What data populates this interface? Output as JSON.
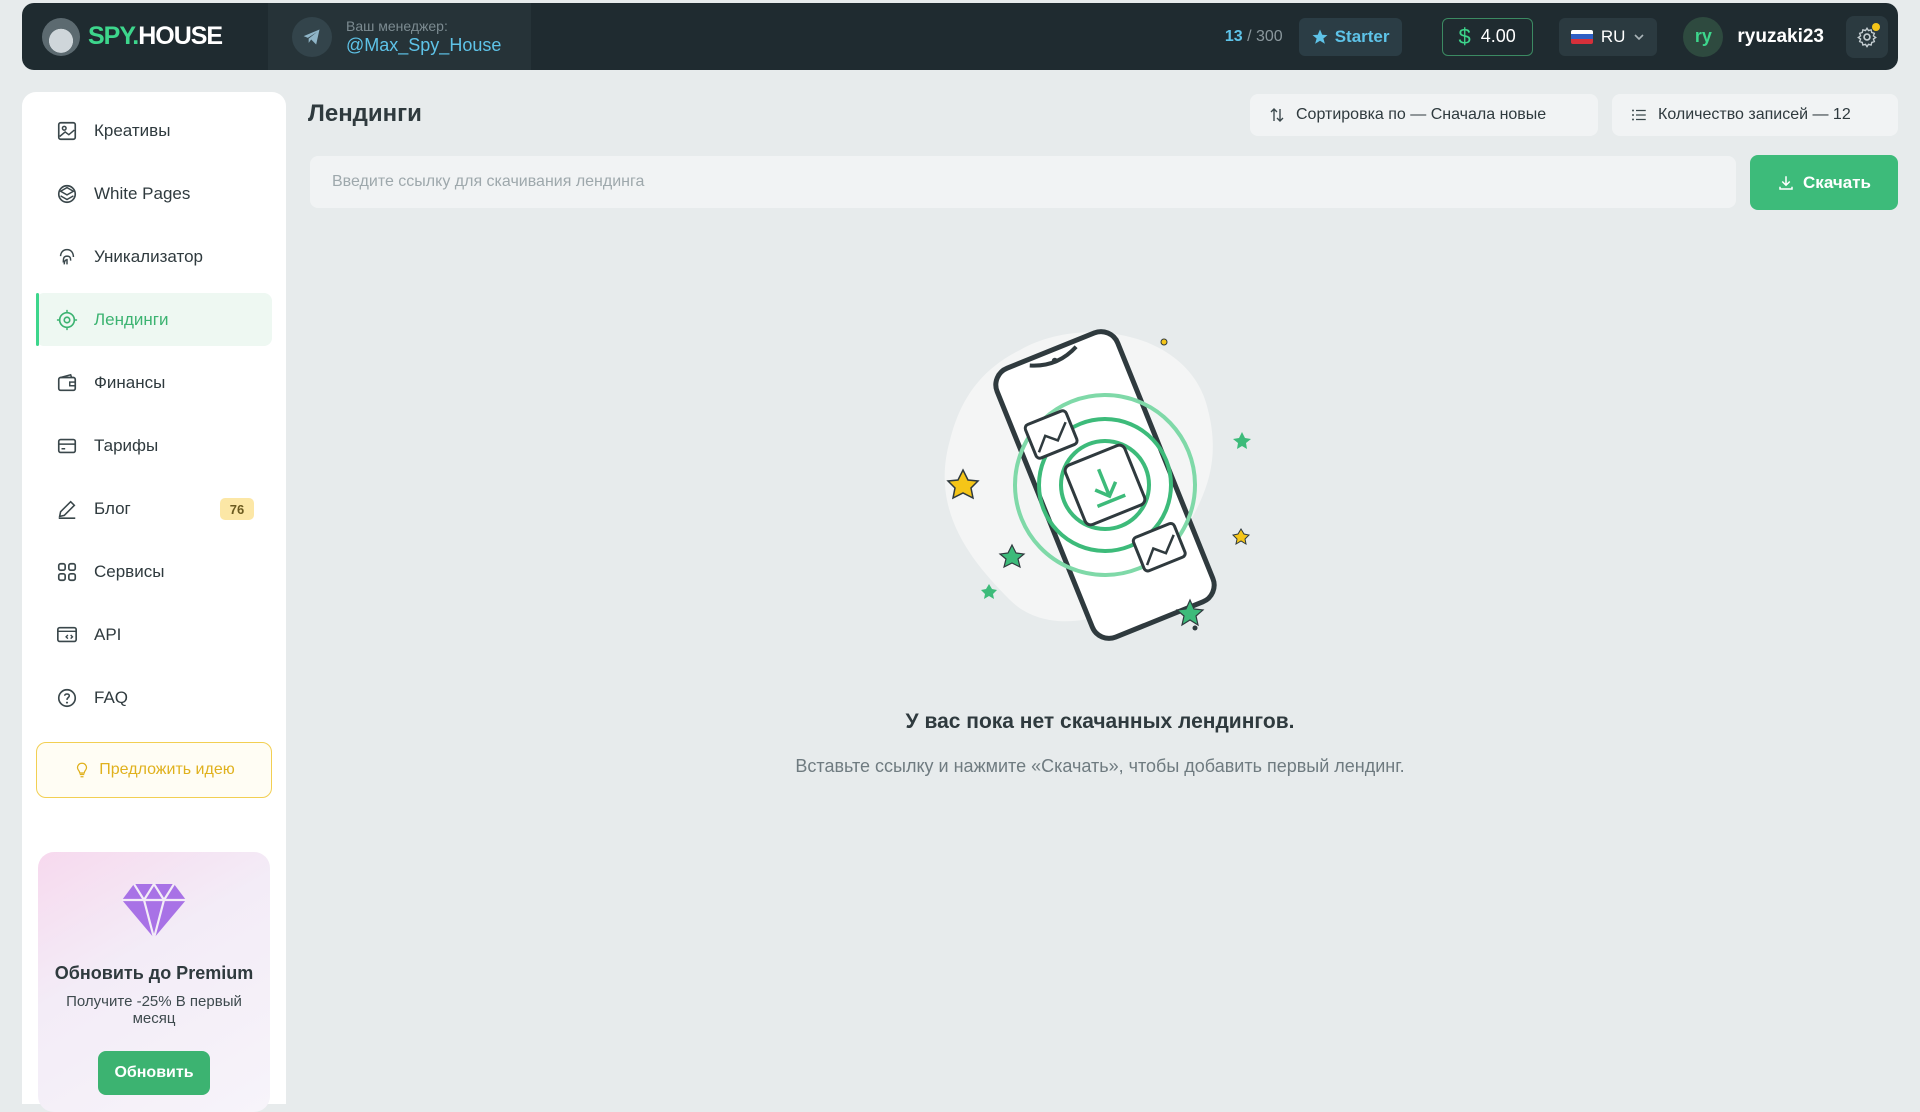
{
  "header": {
    "logo_left": "SPY.",
    "logo_right": "HOUSE",
    "manager_label": "Ваш менеджер:",
    "manager_name": "@Max_Spy_House",
    "counter_used": "13",
    "counter_total": "/ 300",
    "plan": "Starter",
    "balance": "4.00",
    "currency_symbol": "$",
    "language": "RU",
    "avatar_initials": "ry",
    "username": "ryuzaki23"
  },
  "sidebar": {
    "items": [
      {
        "label": "Креативы",
        "icon": "image-frame-icon"
      },
      {
        "label": "White Pages",
        "icon": "layers-icon"
      },
      {
        "label": "Уникализатор",
        "icon": "fingerprint-icon"
      },
      {
        "label": "Лендинги",
        "icon": "target-icon",
        "active": true
      },
      {
        "label": "Финансы",
        "icon": "wallet-icon"
      },
      {
        "label": "Тарифы",
        "icon": "card-icon"
      },
      {
        "label": "Блог",
        "icon": "pencil-icon",
        "badge": "76"
      },
      {
        "label": "Сервисы",
        "icon": "grid-icon"
      },
      {
        "label": "API",
        "icon": "api-icon"
      },
      {
        "label": "FAQ",
        "icon": "question-icon"
      }
    ],
    "idea_button": "Предложить идею",
    "promo": {
      "title": "Обновить до Premium",
      "subtitle": "Получите -25% В первый месяц",
      "button": "Обновить"
    }
  },
  "main": {
    "title": "Лендинги",
    "sort_label": "Сортировка по — Сначала новые",
    "count_label": "Количество записей — 12",
    "url_placeholder": "Введите ссылку для скачивания лендинга",
    "download_button": "Скачать",
    "empty_title": "У вас пока нет скачанных лендингов.",
    "empty_subtitle": "Вставьте ссылку и нажмите «Скачать», чтобы добавить первый лендинг."
  },
  "colors": {
    "accent": "#3dbb7a",
    "header_bg": "#1f2b30",
    "info_blue": "#5ec3e8",
    "badge_yellow": "#fce7a6"
  }
}
